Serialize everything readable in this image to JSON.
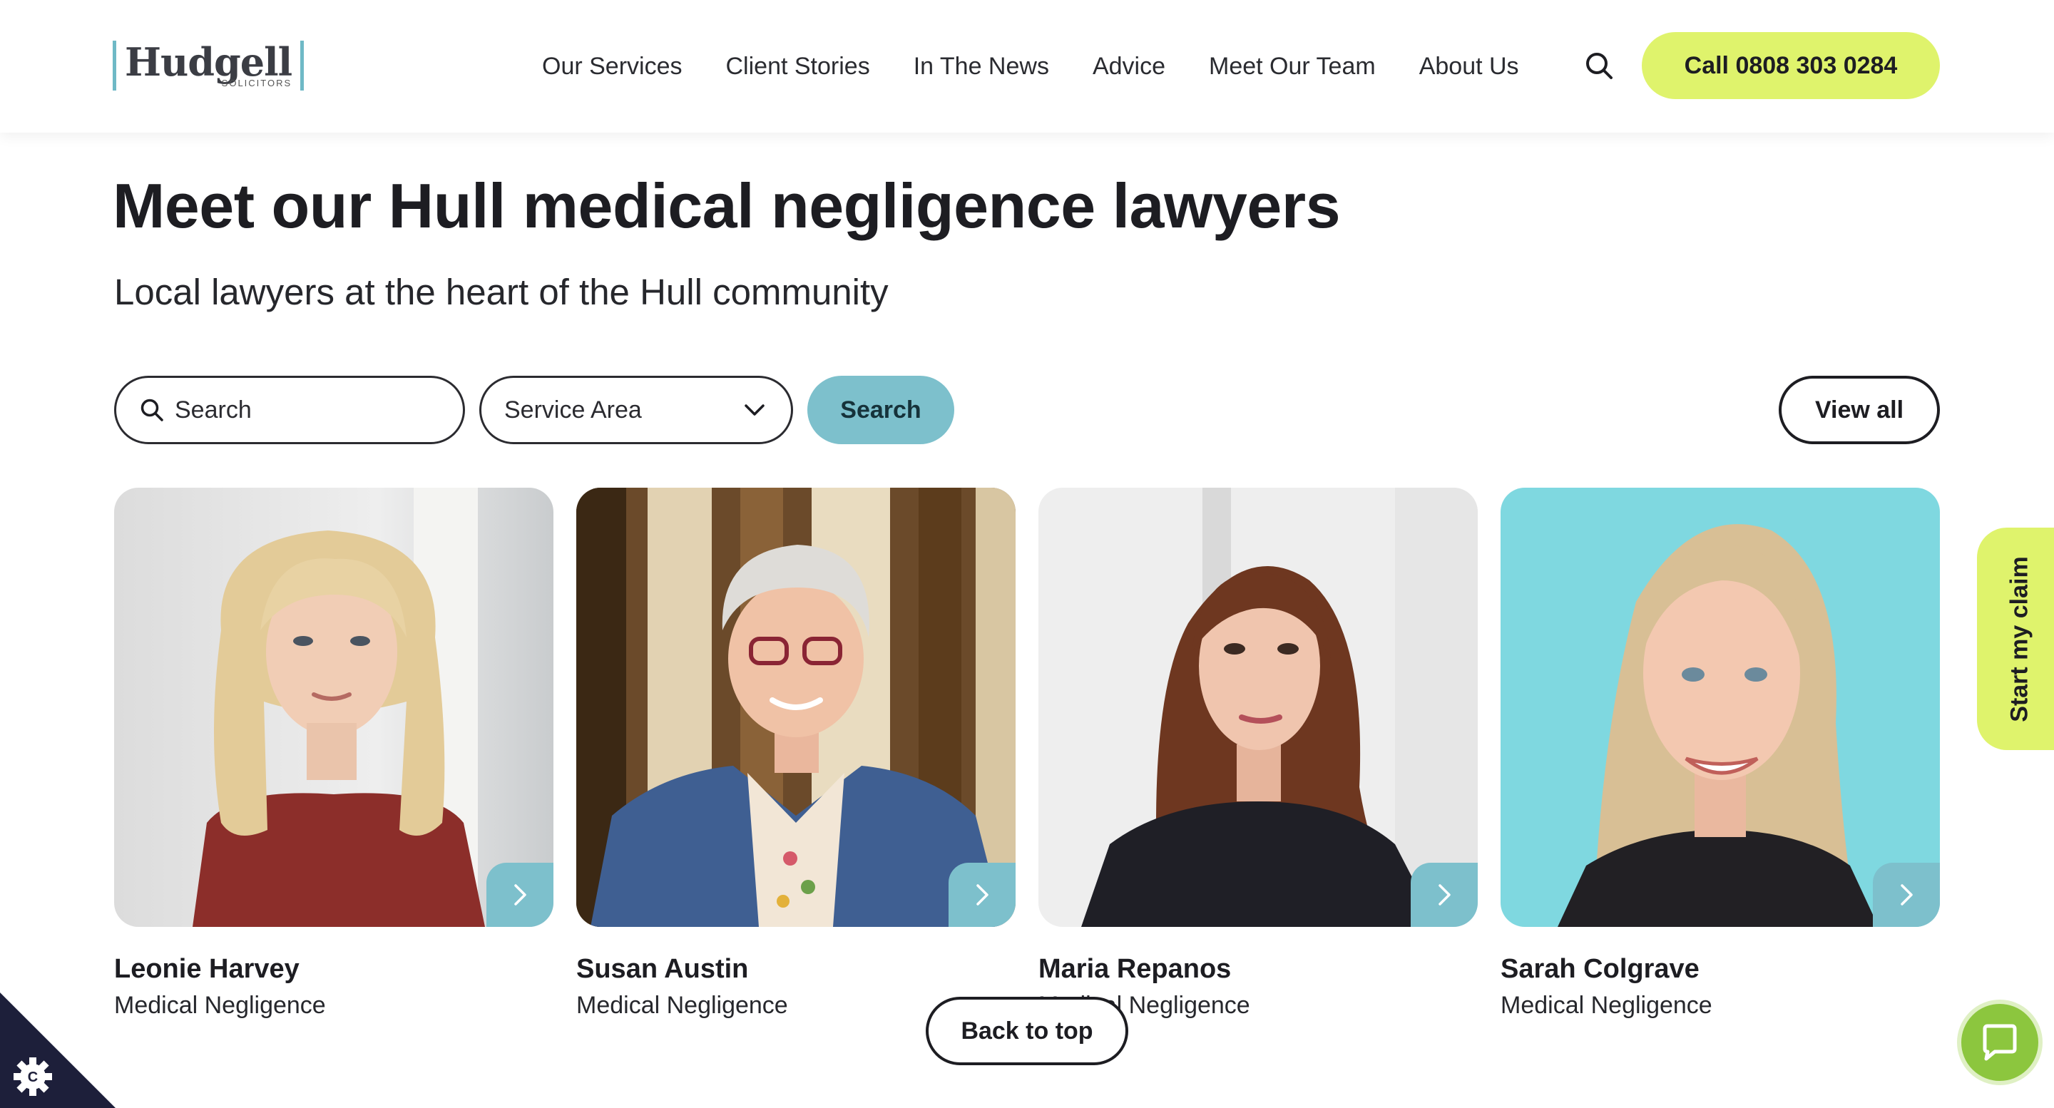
{
  "header": {
    "logo_text": "Hudgell",
    "logo_subtext": "SOLICITORS",
    "nav": [
      "Our Services",
      "Client Stories",
      "In The News",
      "Advice",
      "Meet Our Team",
      "About Us"
    ],
    "call_label": "Call 0808 303 0284"
  },
  "main": {
    "title": "Meet our Hull medical negligence lawyers",
    "subtitle": "Local lawyers at the heart of the Hull community"
  },
  "filters": {
    "search_placeholder": "Search",
    "service_area_label": "Service Area",
    "search_button": "Search",
    "view_all_button": "View all"
  },
  "lawyers": [
    {
      "name": "Leonie Harvey",
      "role": "Medical Negligence"
    },
    {
      "name": "Susan Austin",
      "role": "Medical Negligence"
    },
    {
      "name": "Maria Repanos",
      "role": "Medical Negligence"
    },
    {
      "name": "Sarah Colgrave",
      "role": "Medical Negligence"
    }
  ],
  "floating": {
    "start_claim": "Start my claim",
    "back_to_top": "Back to top"
  },
  "colors": {
    "accent_lime": "#dff36c",
    "accent_teal": "#7dc0cc",
    "chat_green": "#8cc63e",
    "dark": "#1d1d22"
  },
  "icons": [
    "search-icon",
    "chevron-down-icon",
    "chevron-right-icon",
    "chat-icon",
    "cookie-settings-icon"
  ]
}
